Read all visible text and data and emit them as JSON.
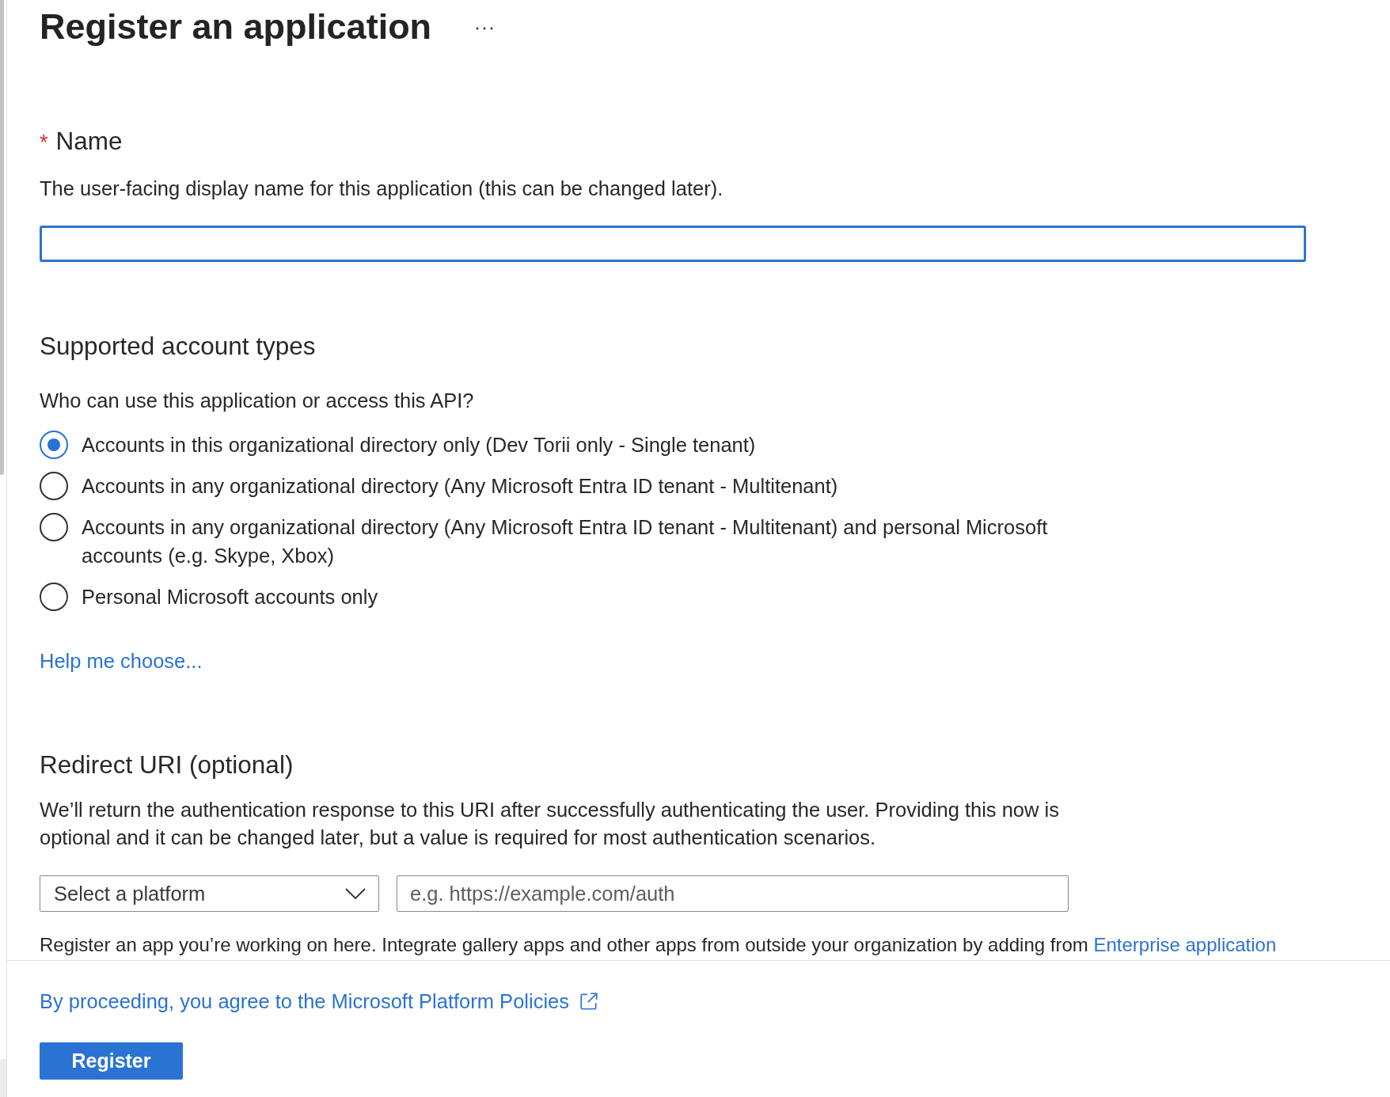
{
  "header": {
    "title": "Register an application"
  },
  "name_section": {
    "required_mark": "*",
    "label": "Name",
    "description": "The user-facing display name for this application (this can be changed later).",
    "name_field": {
      "focused": true
    }
  },
  "account_types": {
    "heading": "Supported account types",
    "question": "Who can use this application or access this API?",
    "options": [
      {
        "label": "Accounts in this organizational directory only (Dev Torii only - Single tenant)",
        "selected": true
      },
      {
        "label": "Accounts in any organizational directory (Any Microsoft Entra ID tenant - Multitenant)",
        "selected": false
      },
      {
        "label": "Accounts in any organizational directory (Any Microsoft Entra ID tenant - Multitenant) and personal Microsoft accounts (e.g. Skype, Xbox)",
        "selected": false
      },
      {
        "label": "Personal Microsoft accounts only",
        "selected": false
      }
    ],
    "help_link": "Help me choose..."
  },
  "redirect_uri": {
    "heading": "Redirect URI (optional)",
    "description": "We’ll return the authentication response to this URI after successfully authenticating the user. Providing this now is optional and it can be changed later, but a value is required for most authentication scenarios.",
    "platform_select": {
      "placeholder": "Select a platform"
    },
    "uri_field": {
      "placeholder": "e.g. https://example.com/auth"
    }
  },
  "intro_note": {
    "text": "Register an app you’re working on here. Integrate gallery apps and other apps from outside your organization by adding from ",
    "link": "Enterprise application"
  },
  "footer": {
    "policy_link": "By proceeding, you agree to the Microsoft Platform Policies",
    "register_button": "Register"
  }
}
